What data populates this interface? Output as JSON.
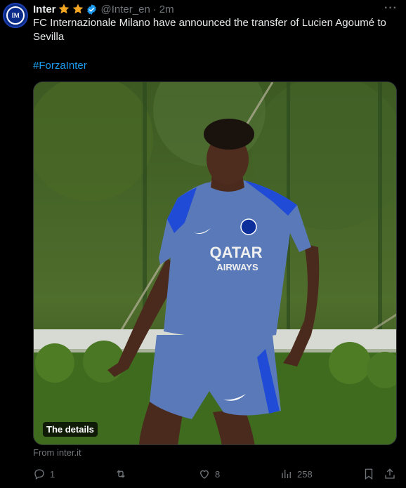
{
  "tweet": {
    "author_name": "Inter",
    "handle": "@Inter_en",
    "separator": "·",
    "time": "2m",
    "more": "···",
    "avatar_text": "IM",
    "text": "FC Internazionale Milano have announced the transfer of Lucien Agoumé to Sevilla",
    "hashtag": "#ForzaInter",
    "media_label": "The details",
    "media_shirt_text_1": "QATAR",
    "media_shirt_text_2": "AIRWAYS",
    "source": "From inter.it"
  },
  "actions": {
    "replies": "1",
    "reposts": "",
    "likes": "8",
    "views": "258"
  },
  "colors": {
    "background": "#000000",
    "text": "#e7e9ea",
    "muted": "#71767b",
    "link": "#1d9bf0",
    "star": "#f5a623",
    "verified": "#1d9bf0"
  },
  "icons": [
    "inter-logo-icon",
    "star-icon",
    "star-icon",
    "verified-icon",
    "more-icon",
    "reply-icon",
    "repost-icon",
    "like-icon",
    "views-icon",
    "bookmark-icon",
    "share-icon"
  ]
}
